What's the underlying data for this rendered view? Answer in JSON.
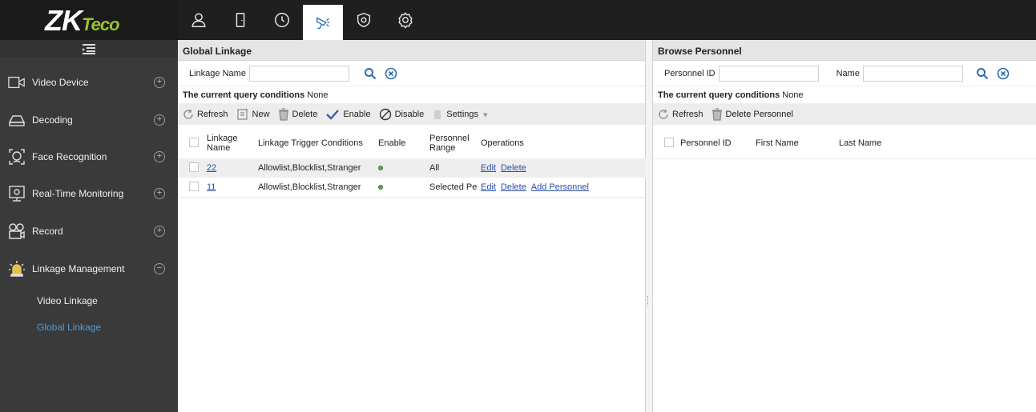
{
  "brand": {
    "logo_main": "ZK",
    "logo_sub": "Teco"
  },
  "top_nav": [
    {
      "icon": "person-icon"
    },
    {
      "icon": "door-icon"
    },
    {
      "icon": "clock-icon"
    },
    {
      "icon": "camera-icon",
      "active": true
    },
    {
      "icon": "shield-icon"
    },
    {
      "icon": "gear-icon"
    }
  ],
  "sidebar": {
    "items": [
      {
        "label": "Video Device",
        "icon": "video-device-icon",
        "toggle": "+"
      },
      {
        "label": "Decoding",
        "icon": "decoding-icon",
        "toggle": "+"
      },
      {
        "label": "Face Recognition",
        "icon": "face-recognition-icon",
        "toggle": "+"
      },
      {
        "label": "Real-Time Monitoring",
        "icon": "monitor-icon",
        "toggle": "+"
      },
      {
        "label": "Record",
        "icon": "record-icon",
        "toggle": "+"
      },
      {
        "label": "Linkage Management",
        "icon": "alarm-icon",
        "toggle": "−"
      }
    ],
    "sub_items": [
      {
        "label": "Video Linkage",
        "active": false
      },
      {
        "label": "Global Linkage",
        "active": true
      }
    ]
  },
  "left_panel": {
    "title": "Global Linkage",
    "query_label": "Linkage Name",
    "query_value": "",
    "cond_label": "The current query conditions",
    "cond_value": "None",
    "toolbar": [
      "Refresh",
      "New",
      "Delete",
      "Enable",
      "Disable",
      "Settings"
    ],
    "columns": [
      "Linkage Name",
      "Linkage Trigger Conditions",
      "Enable",
      "Personnel Range",
      "Operations"
    ],
    "rows": [
      {
        "name": "22",
        "trigger": "Allowlist,Blocklist,Stranger",
        "range": "All",
        "ops": [
          "Edit",
          "Delete"
        ]
      },
      {
        "name": "11",
        "trigger": "Allowlist,Blocklist,Stranger",
        "range": "Selected Pe",
        "ops": [
          "Edit",
          "Delete",
          "Add Personnel"
        ]
      }
    ]
  },
  "right_panel": {
    "title": "Browse Personnel",
    "query_label_id": "Personnel ID",
    "query_label_name": "Name",
    "cond_label": "The current query conditions",
    "cond_value": "None",
    "toolbar": [
      "Refresh",
      "Delete Personnel"
    ],
    "columns": [
      "Personnel ID",
      "First Name",
      "Last Name"
    ]
  }
}
